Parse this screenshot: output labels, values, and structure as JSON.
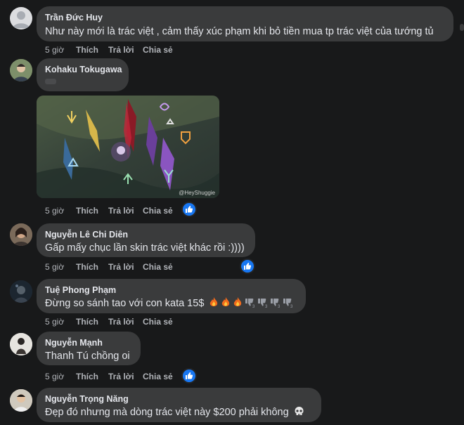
{
  "comments": [
    {
      "author": "Trần Đức Huy",
      "text": "Như này mới là trác việt , cảm thấy xúc phạm khi bỏ tiền mua tp trác việt của tướng tủ",
      "time": "5 giờ",
      "like": "Thích",
      "reply": "Trả lời",
      "share": "Chia sẻ",
      "avatar": "default-avatar"
    },
    {
      "author": "Kohaku Tokugawa",
      "text": "",
      "time": "5 giờ",
      "like": "Thích",
      "reply": "Trả lời",
      "share": "Chia sẻ",
      "avatar": "photo-avatar",
      "has_image": true,
      "image_watermark": "@HeyShuggie",
      "reaction": "like-icon"
    },
    {
      "author": "Nguyễn Lê Chi Diên",
      "text": "Gấp mấy chục lần skin trác việt khác rồi :))))",
      "time": "5 giờ",
      "like": "Thích",
      "reply": "Trả lời",
      "share": "Chia sẻ",
      "avatar": "photo-avatar",
      "reaction": "like-icon"
    },
    {
      "author": "Tuệ Phong Phạm",
      "text": "Đừng so sánh tao với con kata 15$",
      "time": "5 giờ",
      "like": "Thích",
      "reply": "Trả lời",
      "share": "Chia sẻ",
      "avatar": "photo-avatar",
      "emojis": [
        "fire-emoji",
        "fire-emoji",
        "fire-emoji",
        "thumbs-down-emoji",
        "thumbs-down-emoji",
        "thumbs-down-emoji",
        "thumbs-down-emoji"
      ]
    },
    {
      "author": "Nguyễn Mạnh",
      "text": "Thanh Tú chồng oi",
      "time": "5 giờ",
      "like": "Thích",
      "reply": "Trả lời",
      "share": "Chia sẻ",
      "avatar": "photo-avatar",
      "reaction": "like-icon"
    },
    {
      "author": "Nguyễn Trọng Năng",
      "text": "Đẹp đó nhưng mà dòng trác việt này $200 phải không",
      "avatar": "photo-avatar",
      "emojis": [
        "skull-emoji"
      ]
    }
  ],
  "colors": {
    "background": "#18191a",
    "bubble": "#3a3b3c",
    "text": "#e4e6eb",
    "secondary_text": "#b0b3b8",
    "like_blue": "#1877f2"
  }
}
